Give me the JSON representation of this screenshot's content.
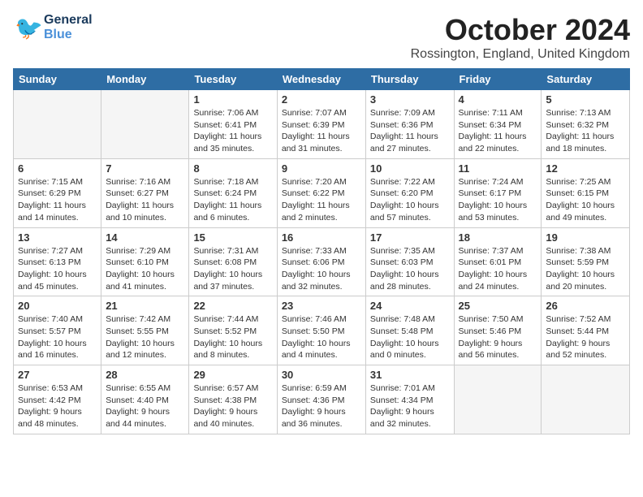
{
  "header": {
    "logo_general": "General",
    "logo_blue": "Blue",
    "month_title": "October 2024",
    "location": "Rossington, England, United Kingdom"
  },
  "weekdays": [
    "Sunday",
    "Monday",
    "Tuesday",
    "Wednesday",
    "Thursday",
    "Friday",
    "Saturday"
  ],
  "weeks": [
    [
      {
        "day": "",
        "info": ""
      },
      {
        "day": "",
        "info": ""
      },
      {
        "day": "1",
        "info": "Sunrise: 7:06 AM\nSunset: 6:41 PM\nDaylight: 11 hours and 35 minutes."
      },
      {
        "day": "2",
        "info": "Sunrise: 7:07 AM\nSunset: 6:39 PM\nDaylight: 11 hours and 31 minutes."
      },
      {
        "day": "3",
        "info": "Sunrise: 7:09 AM\nSunset: 6:36 PM\nDaylight: 11 hours and 27 minutes."
      },
      {
        "day": "4",
        "info": "Sunrise: 7:11 AM\nSunset: 6:34 PM\nDaylight: 11 hours and 22 minutes."
      },
      {
        "day": "5",
        "info": "Sunrise: 7:13 AM\nSunset: 6:32 PM\nDaylight: 11 hours and 18 minutes."
      }
    ],
    [
      {
        "day": "6",
        "info": "Sunrise: 7:15 AM\nSunset: 6:29 PM\nDaylight: 11 hours and 14 minutes."
      },
      {
        "day": "7",
        "info": "Sunrise: 7:16 AM\nSunset: 6:27 PM\nDaylight: 11 hours and 10 minutes."
      },
      {
        "day": "8",
        "info": "Sunrise: 7:18 AM\nSunset: 6:24 PM\nDaylight: 11 hours and 6 minutes."
      },
      {
        "day": "9",
        "info": "Sunrise: 7:20 AM\nSunset: 6:22 PM\nDaylight: 11 hours and 2 minutes."
      },
      {
        "day": "10",
        "info": "Sunrise: 7:22 AM\nSunset: 6:20 PM\nDaylight: 10 hours and 57 minutes."
      },
      {
        "day": "11",
        "info": "Sunrise: 7:24 AM\nSunset: 6:17 PM\nDaylight: 10 hours and 53 minutes."
      },
      {
        "day": "12",
        "info": "Sunrise: 7:25 AM\nSunset: 6:15 PM\nDaylight: 10 hours and 49 minutes."
      }
    ],
    [
      {
        "day": "13",
        "info": "Sunrise: 7:27 AM\nSunset: 6:13 PM\nDaylight: 10 hours and 45 minutes."
      },
      {
        "day": "14",
        "info": "Sunrise: 7:29 AM\nSunset: 6:10 PM\nDaylight: 10 hours and 41 minutes."
      },
      {
        "day": "15",
        "info": "Sunrise: 7:31 AM\nSunset: 6:08 PM\nDaylight: 10 hours and 37 minutes."
      },
      {
        "day": "16",
        "info": "Sunrise: 7:33 AM\nSunset: 6:06 PM\nDaylight: 10 hours and 32 minutes."
      },
      {
        "day": "17",
        "info": "Sunrise: 7:35 AM\nSunset: 6:03 PM\nDaylight: 10 hours and 28 minutes."
      },
      {
        "day": "18",
        "info": "Sunrise: 7:37 AM\nSunset: 6:01 PM\nDaylight: 10 hours and 24 minutes."
      },
      {
        "day": "19",
        "info": "Sunrise: 7:38 AM\nSunset: 5:59 PM\nDaylight: 10 hours and 20 minutes."
      }
    ],
    [
      {
        "day": "20",
        "info": "Sunrise: 7:40 AM\nSunset: 5:57 PM\nDaylight: 10 hours and 16 minutes."
      },
      {
        "day": "21",
        "info": "Sunrise: 7:42 AM\nSunset: 5:55 PM\nDaylight: 10 hours and 12 minutes."
      },
      {
        "day": "22",
        "info": "Sunrise: 7:44 AM\nSunset: 5:52 PM\nDaylight: 10 hours and 8 minutes."
      },
      {
        "day": "23",
        "info": "Sunrise: 7:46 AM\nSunset: 5:50 PM\nDaylight: 10 hours and 4 minutes."
      },
      {
        "day": "24",
        "info": "Sunrise: 7:48 AM\nSunset: 5:48 PM\nDaylight: 10 hours and 0 minutes."
      },
      {
        "day": "25",
        "info": "Sunrise: 7:50 AM\nSunset: 5:46 PM\nDaylight: 9 hours and 56 minutes."
      },
      {
        "day": "26",
        "info": "Sunrise: 7:52 AM\nSunset: 5:44 PM\nDaylight: 9 hours and 52 minutes."
      }
    ],
    [
      {
        "day": "27",
        "info": "Sunrise: 6:53 AM\nSunset: 4:42 PM\nDaylight: 9 hours and 48 minutes."
      },
      {
        "day": "28",
        "info": "Sunrise: 6:55 AM\nSunset: 4:40 PM\nDaylight: 9 hours and 44 minutes."
      },
      {
        "day": "29",
        "info": "Sunrise: 6:57 AM\nSunset: 4:38 PM\nDaylight: 9 hours and 40 minutes."
      },
      {
        "day": "30",
        "info": "Sunrise: 6:59 AM\nSunset: 4:36 PM\nDaylight: 9 hours and 36 minutes."
      },
      {
        "day": "31",
        "info": "Sunrise: 7:01 AM\nSunset: 4:34 PM\nDaylight: 9 hours and 32 minutes."
      },
      {
        "day": "",
        "info": ""
      },
      {
        "day": "",
        "info": ""
      }
    ]
  ]
}
